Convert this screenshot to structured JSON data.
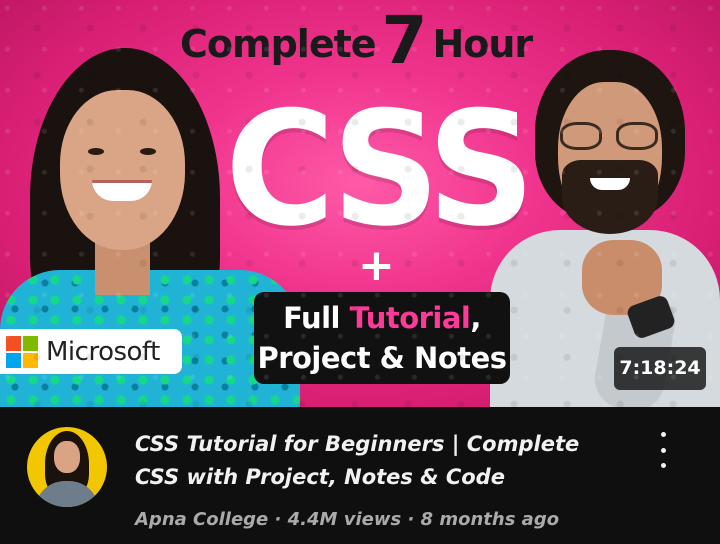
{
  "thumbnail": {
    "headline_prefix": "Complete",
    "headline_number": "7",
    "headline_suffix": "Hour",
    "main_word": "CSS",
    "plus_sign": "+",
    "box_line1_a": "Full ",
    "box_line1_b": "Tutorial",
    "box_line1_c": ",",
    "box_line2": "Project & Notes",
    "badge_text": "Microsoft",
    "duration": "7:18:24",
    "colors": {
      "background": "#f0348d",
      "accent_pink": "#ff3b9a",
      "ms_red": "#f25022",
      "ms_green": "#7fba00",
      "ms_blue": "#00a4ef",
      "ms_yellow": "#ffb900"
    }
  },
  "video": {
    "title_line1": "CSS Tutorial for Beginners | Complete",
    "title_line2": "CSS with Project, Notes & Code",
    "channel": "Apna College",
    "separator": " · ",
    "views": "4.4M views",
    "age": "8 months ago",
    "menu_icon": "more-vertical-icon"
  }
}
